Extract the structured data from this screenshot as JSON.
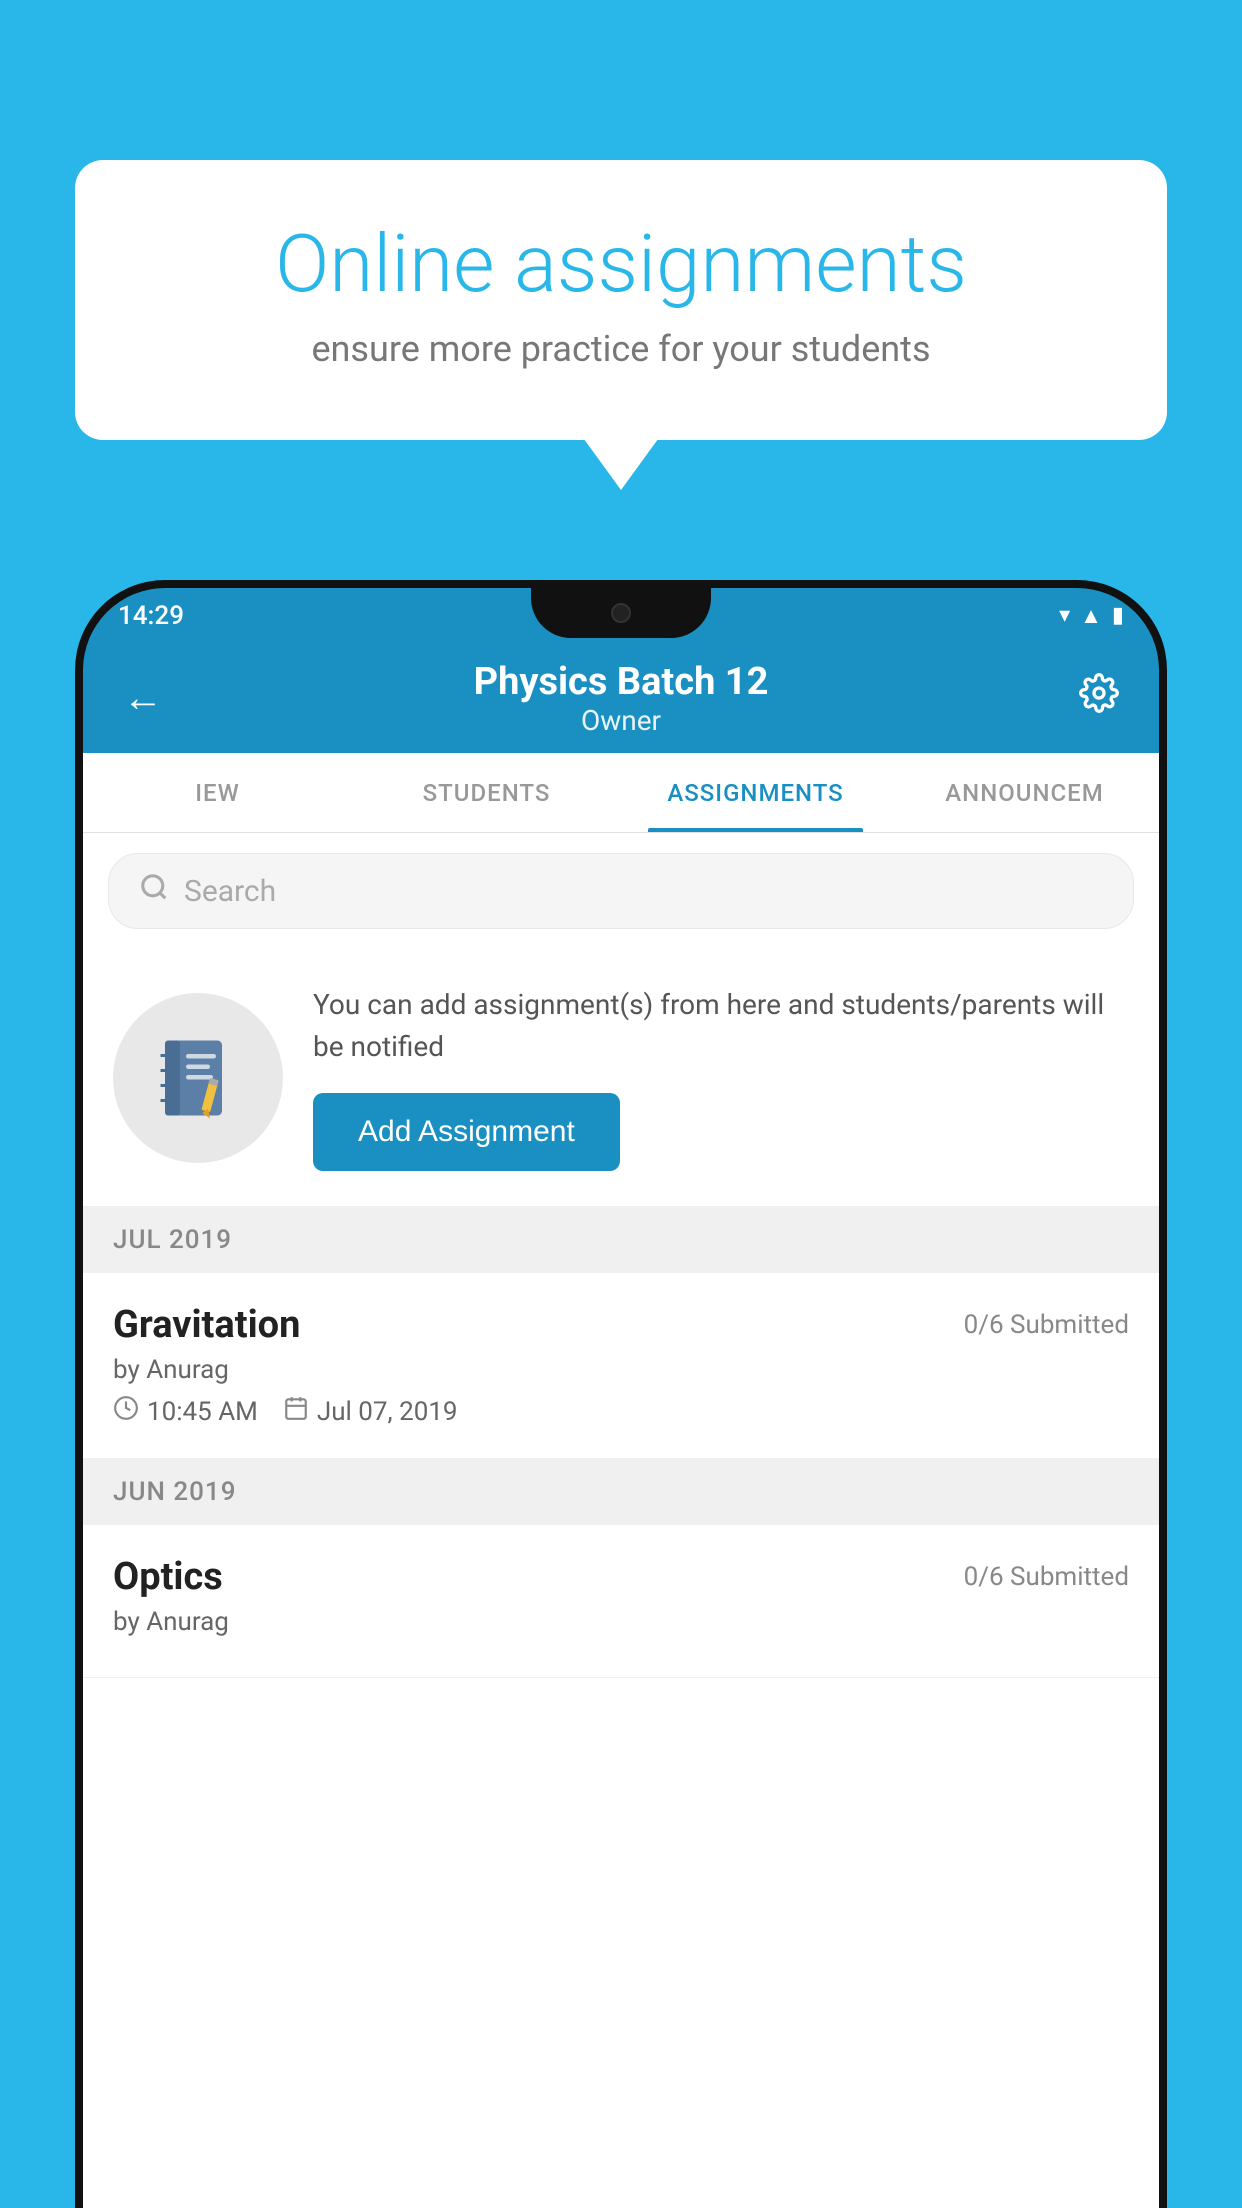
{
  "background_color": "#29b6e8",
  "promo": {
    "title": "Online assignments",
    "subtitle": "ensure more practice for your students"
  },
  "status_bar": {
    "time": "14:29",
    "icons": [
      "wifi",
      "signal",
      "battery"
    ]
  },
  "app_bar": {
    "title": "Physics Batch 12",
    "subtitle": "Owner",
    "back_label": "←",
    "settings_label": "⚙"
  },
  "tabs": [
    {
      "label": "IEW",
      "active": false
    },
    {
      "label": "STUDENTS",
      "active": false
    },
    {
      "label": "ASSIGNMENTS",
      "active": true
    },
    {
      "label": "ANNOUNCEM",
      "active": false
    }
  ],
  "search": {
    "placeholder": "Search"
  },
  "promo_section": {
    "description": "You can add assignment(s) from here and students/parents will be notified",
    "button_label": "Add Assignment"
  },
  "sections": [
    {
      "month": "JUL 2019",
      "assignments": [
        {
          "name": "Gravitation",
          "submitted": "0/6 Submitted",
          "by": "by Anurag",
          "time": "10:45 AM",
          "date": "Jul 07, 2019"
        }
      ]
    },
    {
      "month": "JUN 2019",
      "assignments": [
        {
          "name": "Optics",
          "submitted": "0/6 Submitted",
          "by": "by Anurag",
          "time": "",
          "date": ""
        }
      ]
    }
  ]
}
